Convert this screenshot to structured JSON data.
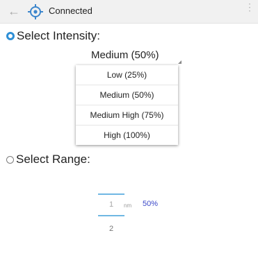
{
  "appbar": {
    "back_icon": "arrow-left-icon",
    "status_icon": "crosshair-target-icon",
    "title": "Connected",
    "menu_icon": "more-vert-icon"
  },
  "intensity": {
    "label": "Select Intensity:",
    "selected": true,
    "current_value": "Medium (50%)",
    "options": [
      "Low (25%)",
      "Medium (50%)",
      "Medium High (75%)",
      "High (100%)"
    ]
  },
  "range": {
    "label": "Select Range:",
    "selected": false,
    "picker_current": "1",
    "picker_next": "2",
    "unit": "nm",
    "percent": "50%"
  },
  "colors": {
    "accent": "#2e8fd6",
    "percent_text": "#3a47c8",
    "picker_line": "#6fb7e3"
  }
}
